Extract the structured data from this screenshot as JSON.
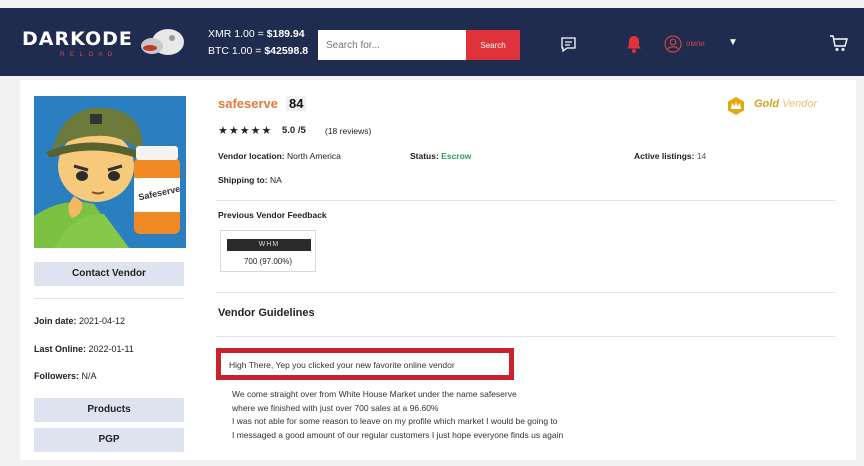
{
  "header": {
    "logo": "DARKODE",
    "logo_sub": "R E L O A D",
    "xmr_label": "XMR 1.00 = ",
    "xmr_price": "$189.94",
    "btc_label": "BTC 1.00 = ",
    "btc_price": "$42598.8",
    "search_placeholder": "Search for...",
    "search_button": "Search",
    "user": "oмпи"
  },
  "sidebar": {
    "contact_button": "Contact Vendor",
    "join_label": "Join date: ",
    "join_value": "2021-04-12",
    "last_online_label": "Last Online: ",
    "last_online_value": "2022-01-11",
    "followers_label": "Followers: ",
    "followers_value": "N/A",
    "products_button": "Products",
    "pgp_button": "PGP",
    "avatar_bottle_label": "Safeserve"
  },
  "vendor": {
    "name": "safeserve",
    "score": "84",
    "stars": "★★★★★",
    "rating": "5.0 /5",
    "reviews": "(18 reviews)",
    "location_label": "Vendor location: ",
    "location_value": "North America",
    "status_label": "Status: ",
    "status_value": "Escrow",
    "listings_label": "Active listings: ",
    "listings_value": "14",
    "shipping_label": "Shipping to: ",
    "shipping_value": "NA",
    "badge_level": "Gold",
    "badge_suffix": "Vendor"
  },
  "feedback": {
    "title": "Previous Vendor Feedback",
    "market_label": "WHM",
    "value": "700 (97.00%)"
  },
  "guidelines": {
    "title": "Vendor Guidelines",
    "highlight": "High There, Yep you clicked your new favorite online vendor",
    "lines": [
      "We come straight over from White House Market under the name safeserve",
      "where we finished with just over 700 sales at a 96.60%",
      "I was not able for some reason to leave on my profile which market I would be going to",
      "I messaged a good amount of our regular customers I just hope everyone finds us again"
    ]
  },
  "colors": {
    "header_bg": "#1f2b4f",
    "search_button": "#e0323a",
    "vendor_name": "#e07a3a",
    "escrow": "#2e9b5a",
    "gold": "#d4a21a",
    "highlight_border": "#c8222a"
  }
}
